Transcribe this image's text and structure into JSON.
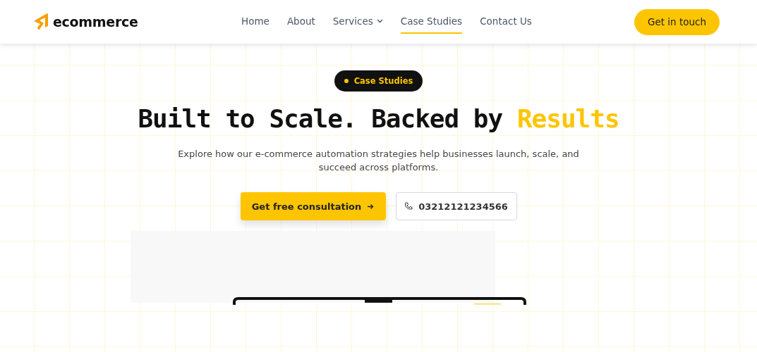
{
  "header": {
    "logo": "ecommerce",
    "nav": [
      {
        "label": "Home",
        "selected": false,
        "has_menu": false
      },
      {
        "label": "About",
        "selected": false,
        "has_menu": false
      },
      {
        "label": "Services",
        "selected": false,
        "has_menu": true
      },
      {
        "label": "Case Studies",
        "selected": true,
        "has_menu": false
      },
      {
        "label": "Contact Us",
        "selected": false,
        "has_menu": false
      }
    ],
    "cta": "Get in touch"
  },
  "hero": {
    "badge": "Case Studies",
    "title": "Built to Scale. Backed by",
    "title_highlight": "Results",
    "description": "Explore how our e-commerce automation strategies help businesses launch, scale, and succeed across platforms.",
    "primary_button": "Get free consultation",
    "phone_button": "03212121234566"
  }
}
